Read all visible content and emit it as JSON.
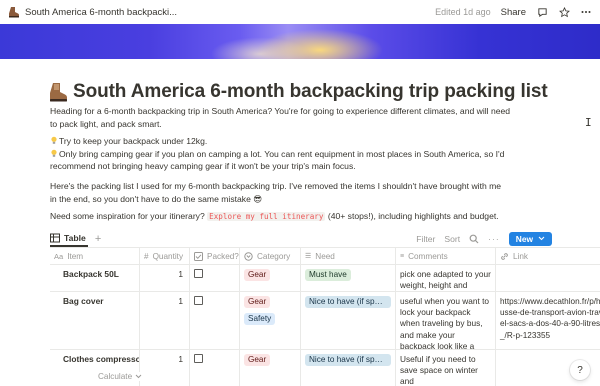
{
  "topbar": {
    "breadcrumb": "South America 6-month backpacki...",
    "edited": "Edited 1d ago",
    "share": "Share",
    "page_icon": "hiking-boot-icon"
  },
  "page": {
    "title": "South America 6-month backpacking trip packing list",
    "title_icon": "hiking-boot-icon",
    "intro_line1": "Heading for a 6-month backpacking trip in South America? You're for going to experience different climates, and will need",
    "intro_line2": "to pack light, and pack smart.",
    "tip1": "Try to keep your backpack under 12kg.",
    "tip2_line1": "Only bring camping gear if you plan on camping a lot. You can rent equipment in most places in South America, so I'd",
    "tip2_line2": "recommend not bringing heavy camping gear if it won't be your trip's main focus.",
    "list_line1": "Here's the packing list I used for my 6-month backpacking trip. I've removed the items I shouldn't have brought with me",
    "list_line2": "in the end, so you don't have to do the same mistake",
    "list_emoji": "😎",
    "inspo_prefix": "Need some inspiration for your itinerary?",
    "inspo_code": "Explore my full itinerary",
    "inspo_suffix": "(40+ stops!), including highlights and budget."
  },
  "database": {
    "view_tab": "Table",
    "filter": "Filter",
    "sort": "Sort",
    "new_button": "New",
    "columns": {
      "item": "Item",
      "quantity": "Quantity",
      "packed": "Packed?",
      "category": "Category",
      "need": "Need",
      "comments": "Comments",
      "link": "Link"
    },
    "rows": [
      {
        "item": "Backpack 50L",
        "quantity": "1",
        "category": [
          "Gear"
        ],
        "need": "Must have",
        "comments": "pick one adapted to your weight, height and gender",
        "link": ""
      },
      {
        "item": "Bag cover",
        "quantity": "1",
        "category": [
          "Gear",
          "Safety"
        ],
        "need": "Nice to have (if space all...",
        "comments": "useful when you want to lock your backpack when traveling by bus, and make your backpack look like a random black bag",
        "link": "https://www.decathlon.fr/p/housse-de-transport-avion-travel-sacs-a-dos-40-a-90-litres/_/R-p-123355"
      },
      {
        "item": "Clothes compressor",
        "quantity": "1",
        "category": [
          "Gear"
        ],
        "need": "Nice to have (if space all...",
        "comments": "Useful if you need to save space on winter and",
        "link": ""
      }
    ],
    "calculate": "Calculate"
  },
  "help": "?"
}
